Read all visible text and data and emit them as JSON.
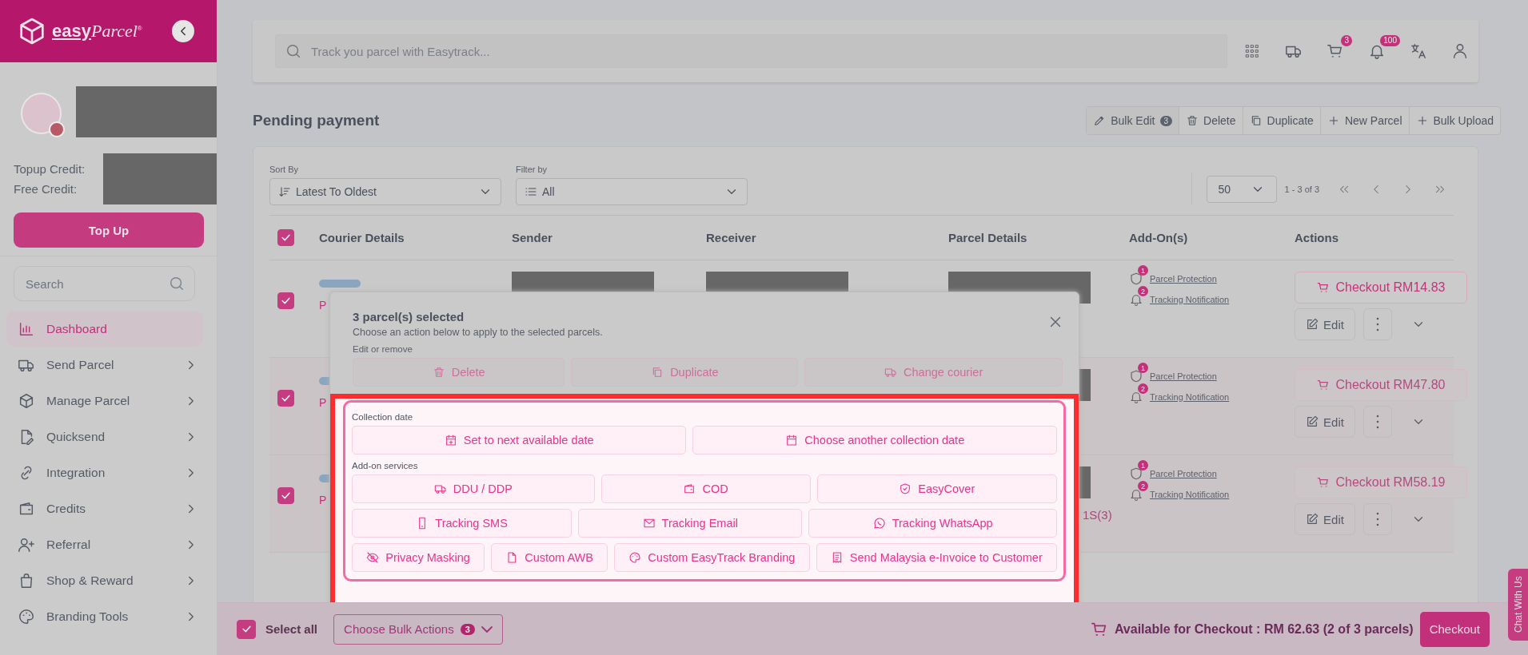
{
  "sidebar": {
    "logo": {
      "word": "easy",
      "script": "Parcel",
      "mark": "®"
    },
    "credits": [
      {
        "label": "Topup Credit:"
      },
      {
        "label": "Free Credit:"
      }
    ],
    "topup_button": "Top Up",
    "search": {
      "placeholder": "Search"
    },
    "nav": [
      {
        "label": "Dashboard",
        "selected": true
      },
      {
        "label": "Send Parcel",
        "selected": false
      },
      {
        "label": "Manage Parcel",
        "selected": false
      },
      {
        "label": "Quicksend",
        "selected": false
      },
      {
        "label": "Integration",
        "selected": false
      },
      {
        "label": "Credits",
        "selected": false
      },
      {
        "label": "Referral",
        "selected": false
      },
      {
        "label": "Shop & Reward",
        "selected": false
      },
      {
        "label": "Branding Tools",
        "selected": false
      }
    ]
  },
  "topbar": {
    "search": {
      "placeholder": "Track you parcel with Easytrack..."
    },
    "cart_badge": "3",
    "notification_badge": "100"
  },
  "page_title": "Pending payment",
  "toolbar": [
    {
      "label": "Bulk Edit",
      "badge": "3"
    },
    {
      "label": "Delete"
    },
    {
      "label": "Duplicate"
    },
    {
      "label": "New Parcel"
    },
    {
      "label": "Bulk Upload"
    }
  ],
  "filters": [
    {
      "label": "Sort By",
      "value": "Latest To Oldest"
    },
    {
      "label": "Filter by",
      "value": "All"
    }
  ],
  "pagination": {
    "page_size": "50",
    "range": "1 - 3 of 3"
  },
  "table": {
    "all_checked": true,
    "columns": [
      "Courier Details",
      "Sender",
      "Receiver",
      "Parcel Details",
      "Add-On(s)",
      "Actions"
    ],
    "rows": [
      {
        "checked": true,
        "highlighted": false,
        "courier_text": "P",
        "addons": [
          {
            "count": "1",
            "label": "Parcel Protection"
          },
          {
            "count": "2",
            "label": "Tracking Notification"
          }
        ],
        "checkout": "Checkout RM14.83",
        "edit": "Edit"
      },
      {
        "checked": true,
        "highlighted": true,
        "courier_text": "P",
        "addons": [
          {
            "count": "1",
            "label": "Parcel Protection"
          },
          {
            "count": "2",
            "label": "Tracking Notification"
          }
        ],
        "checkout": "Checkout RM47.80",
        "edit": "Edit"
      },
      {
        "checked": true,
        "highlighted": true,
        "courier_text": "P",
        "parcel_text": "1S(3)",
        "addons": [
          {
            "count": "1",
            "label": "Parcel Protection"
          },
          {
            "count": "2",
            "label": "Tracking Notification"
          }
        ],
        "checkout": "Checkout RM58.19",
        "edit": "Edit"
      }
    ]
  },
  "modal": {
    "title": "3 parcel(s) selected",
    "subtitle": "Choose an action below to apply to the selected parcels.",
    "sections": [
      {
        "label": "Edit or remove",
        "highlighted": false,
        "button_lines": [
          {
            "buttons": [
              "Delete",
              "Duplicate",
              "Change courier"
            ]
          }
        ]
      },
      {
        "label": "Collection date",
        "highlighted": true,
        "button_lines": [
          {
            "buttons": [
              "Set to next available date",
              "Choose another collection date"
            ]
          }
        ]
      },
      {
        "label": "Add-on services",
        "highlighted": true,
        "button_lines": [
          {
            "buttons": [
              "DDU / DDP",
              "COD",
              "EasyCover"
            ]
          },
          {
            "buttons": [
              "Tracking SMS",
              "Tracking Email",
              "Tracking WhatsApp"
            ]
          },
          {
            "buttons": [
              "Privacy Masking",
              "Custom AWB",
              "Custom EasyTrack Branding",
              "Send Malaysia e-Invoice to Customer"
            ]
          }
        ]
      }
    ]
  },
  "bottom_bar": {
    "select_all": {
      "label": "Select all",
      "checked": true
    },
    "bulk_actions": {
      "label": "Choose Bulk Actions",
      "badge": "3"
    },
    "summary": "Available for Checkout : RM 62.63 (2 of 3 parcels)",
    "checkout": "Checkout"
  },
  "chat_tab": "Chat With Us"
}
